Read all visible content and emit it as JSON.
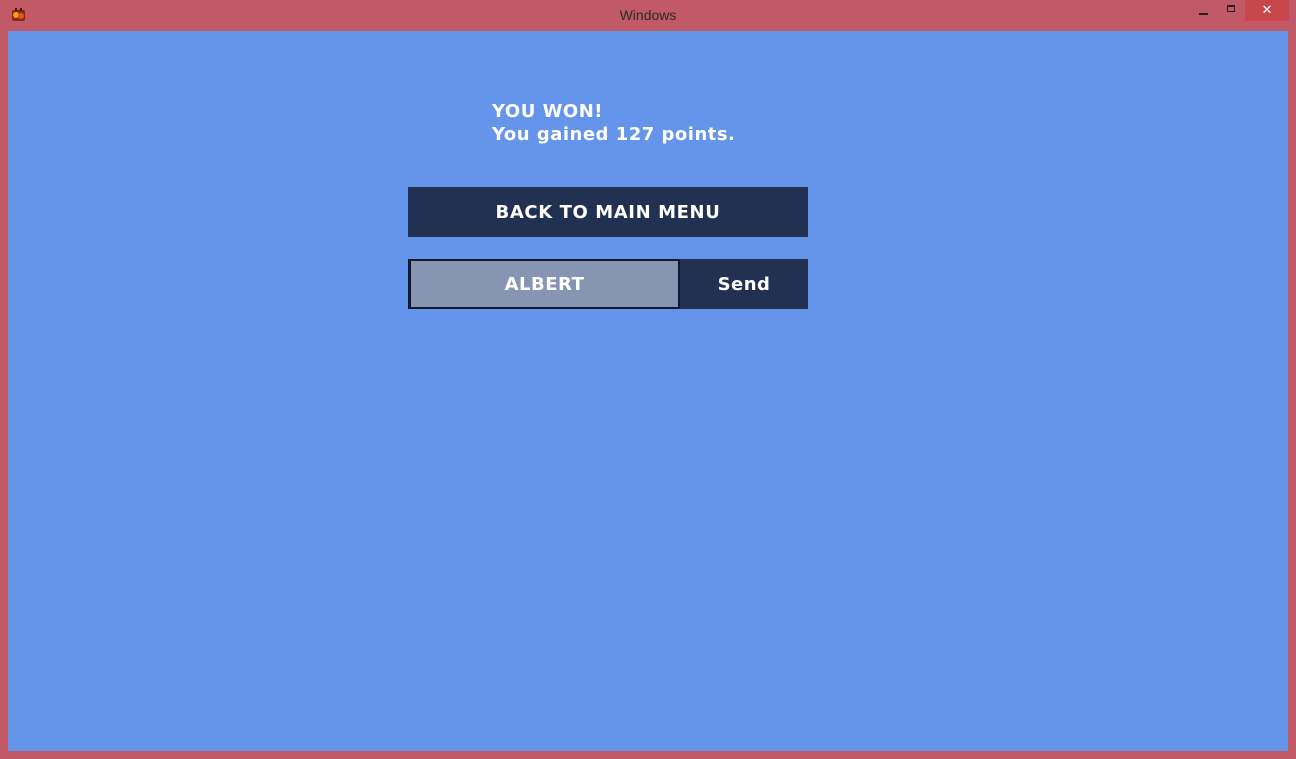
{
  "window": {
    "title": "Windows",
    "close_label": "✕",
    "icons": {
      "app": "game-app-icon",
      "minimize": "minimize-icon",
      "maximize": "maximize-icon",
      "close": "close-icon"
    }
  },
  "game_over": {
    "result_text": "YOU WON!",
    "points_text": "You gained 127 points.",
    "back_button_label": "BACK TO MAIN MENU",
    "name_input_value": "ALBERT",
    "send_button_label": "Send"
  },
  "colors": {
    "frame": "#c15a66",
    "background": "#6495ea",
    "button": "#213152",
    "input": "#8696b2",
    "text": "#ffffff"
  }
}
